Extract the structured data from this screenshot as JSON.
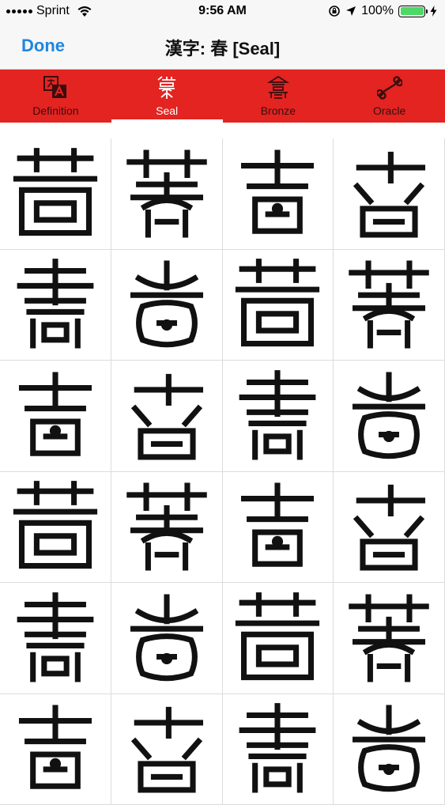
{
  "status_bar": {
    "carrier": "Sprint",
    "time": "9:56 AM",
    "battery_percent": "100%",
    "battery_level": 1.0,
    "icons": [
      "signal-icon",
      "wifi-icon",
      "rotation-lock-icon",
      "location-icon",
      "battery-icon",
      "charging-icon"
    ]
  },
  "nav": {
    "done_label": "Done",
    "title": "漢字: 春 [Seal]"
  },
  "tabs": [
    {
      "label": "Definition",
      "icon": "definition-icon",
      "active": false
    },
    {
      "label": "Seal",
      "icon": "seal-script-icon",
      "active": true
    },
    {
      "label": "Bronze",
      "icon": "bronze-icon",
      "active": false
    },
    {
      "label": "Oracle",
      "icon": "oracle-bone-icon",
      "active": false
    }
  ],
  "glyph_grid": {
    "character": "春",
    "script": "Seal",
    "rows": 6,
    "columns": 4,
    "variant_count": 24
  },
  "colors": {
    "accent": "#1f86e0",
    "tab_bar": "#e32421",
    "tab_active_text": "#ffffff",
    "tab_inactive_text": "#3a0e0e",
    "glyph_ink": "#111111"
  }
}
